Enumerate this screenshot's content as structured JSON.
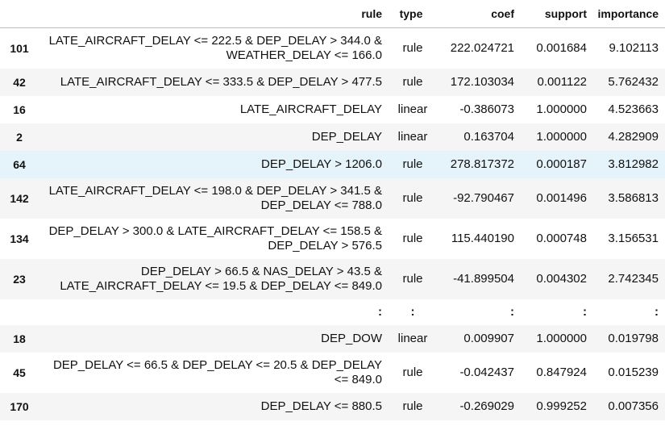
{
  "table": {
    "columns": {
      "index": "",
      "rule": "rule",
      "type": "type",
      "coef": "coef",
      "support": "support",
      "importance": "importance"
    },
    "rows_top": [
      {
        "idx": "101",
        "rule": "LATE_AIRCRAFT_DELAY <= 222.5 & DEP_DELAY > 344.0 & WEATHER_DELAY <= 166.0",
        "type": "rule",
        "coef": "222.024721",
        "support": "0.001684",
        "importance": "9.102113"
      },
      {
        "idx": "42",
        "rule": "LATE_AIRCRAFT_DELAY <= 333.5 & DEP_DELAY > 477.5",
        "type": "rule",
        "coef": "172.103034",
        "support": "0.001122",
        "importance": "5.762432"
      },
      {
        "idx": "16",
        "rule": "LATE_AIRCRAFT_DELAY",
        "type": "linear",
        "coef": "-0.386073",
        "support": "1.000000",
        "importance": "4.523663"
      },
      {
        "idx": "2",
        "rule": "DEP_DELAY",
        "type": "linear",
        "coef": "0.163704",
        "support": "1.000000",
        "importance": "4.282909"
      },
      {
        "idx": "64",
        "rule": "DEP_DELAY > 1206.0",
        "type": "rule",
        "coef": "278.817372",
        "support": "0.000187",
        "importance": "3.812982"
      },
      {
        "idx": "142",
        "rule": "LATE_AIRCRAFT_DELAY <= 198.0 & DEP_DELAY > 341.5 & DEP_DELAY <= 788.0",
        "type": "rule",
        "coef": "-92.790467",
        "support": "0.001496",
        "importance": "3.586813"
      },
      {
        "idx": "134",
        "rule": "DEP_DELAY > 300.0 & LATE_AIRCRAFT_DELAY <= 158.5 & DEP_DELAY > 576.5",
        "type": "rule",
        "coef": "115.440190",
        "support": "0.000748",
        "importance": "3.156531"
      },
      {
        "idx": "23",
        "rule": "DEP_DELAY > 66.5 & NAS_DELAY > 43.5 & LATE_AIRCRAFT_DELAY <= 19.5 & DEP_DELAY <= 849.0",
        "type": "rule",
        "coef": "-41.899504",
        "support": "0.004302",
        "importance": "2.742345"
      }
    ],
    "ellipsis": {
      "idx": "",
      "rule": ":",
      "type": ":",
      "coef": ":",
      "support": ":",
      "importance": ":"
    },
    "rows_bottom": [
      {
        "idx": "18",
        "rule": "DEP_DOW",
        "type": "linear",
        "coef": "0.009907",
        "support": "1.000000",
        "importance": "0.019798"
      },
      {
        "idx": "45",
        "rule": "DEP_DELAY <= 66.5 & DEP_DELAY <= 20.5 & DEP_DELAY <= 849.0",
        "type": "rule",
        "coef": "-0.042437",
        "support": "0.847924",
        "importance": "0.015239"
      },
      {
        "idx": "170",
        "rule": "DEP_DELAY <= 880.5",
        "type": "rule",
        "coef": "-0.269029",
        "support": "0.999252",
        "importance": "0.007356"
      }
    ]
  }
}
